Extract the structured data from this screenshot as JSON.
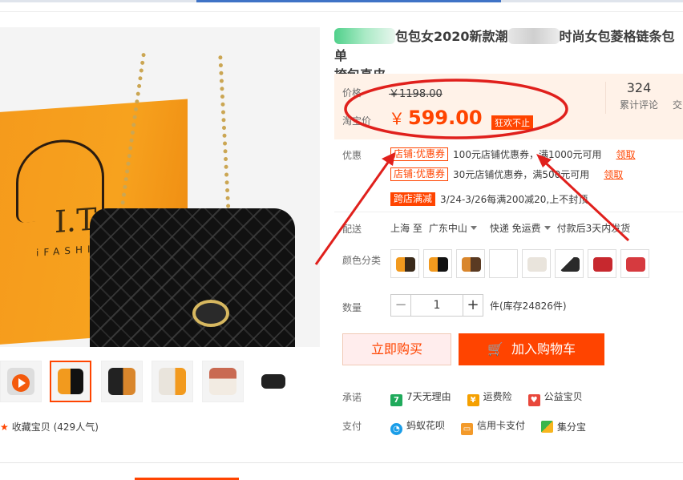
{
  "title": {
    "part1": "包包女2020新款潮",
    "part2": "时尚女包菱格链条包单",
    "part3": "挎包真皮"
  },
  "price": {
    "original_label": "价格",
    "original_value": "￥1198.00",
    "promo_label": "淘宝价",
    "promo_currency": "￥",
    "promo_value": "599.00",
    "promo_tag": "狂欢不止",
    "review_count": "324",
    "review_label": "累计评论",
    "trade_label": "交"
  },
  "coupons": {
    "label": "优惠",
    "items": [
      {
        "tag": "店铺:优惠券",
        "text": "100元店铺优惠券，满1000元可用",
        "link": "领取"
      },
      {
        "tag": "店铺:优惠券",
        "text": "30元店铺优惠券，满500元可用",
        "link": "领取"
      }
    ],
    "cross_tag": "跨店满减",
    "cross_text": "3/24-3/26每满200减20,上不封顶"
  },
  "shipping": {
    "label": "配送",
    "from": "上海 至",
    "to": "广东中山",
    "method": "快递 免运费",
    "time": "付款后3天内发货"
  },
  "colors": {
    "label": "颜色分类",
    "swatches": [
      "#3a2a1a",
      "#f29a1e",
      "#d9862c",
      "#ffffff",
      "#e9e4dc",
      "#2a2a2a",
      "#c7282e",
      "#d63a3f"
    ]
  },
  "quantity": {
    "label": "数量",
    "minus": "−",
    "value": "1",
    "plus": "+",
    "stock": "件(库存24826件)"
  },
  "actions": {
    "buy_now": "立即购买",
    "add_cart": "加入购物车"
  },
  "promise": {
    "label": "承诺",
    "items": [
      "7天无理由",
      "运费险",
      "公益宝贝"
    ]
  },
  "payment": {
    "label": "支付",
    "items": [
      "蚂蚁花呗",
      "信用卡支付",
      "集分宝"
    ]
  },
  "gallery": {
    "box_logo": "I.T",
    "box_logo_sub": "iFASHION",
    "favorite": "收藏宝贝",
    "popularity": "(429人气)"
  },
  "accent_color": "#ff4400"
}
